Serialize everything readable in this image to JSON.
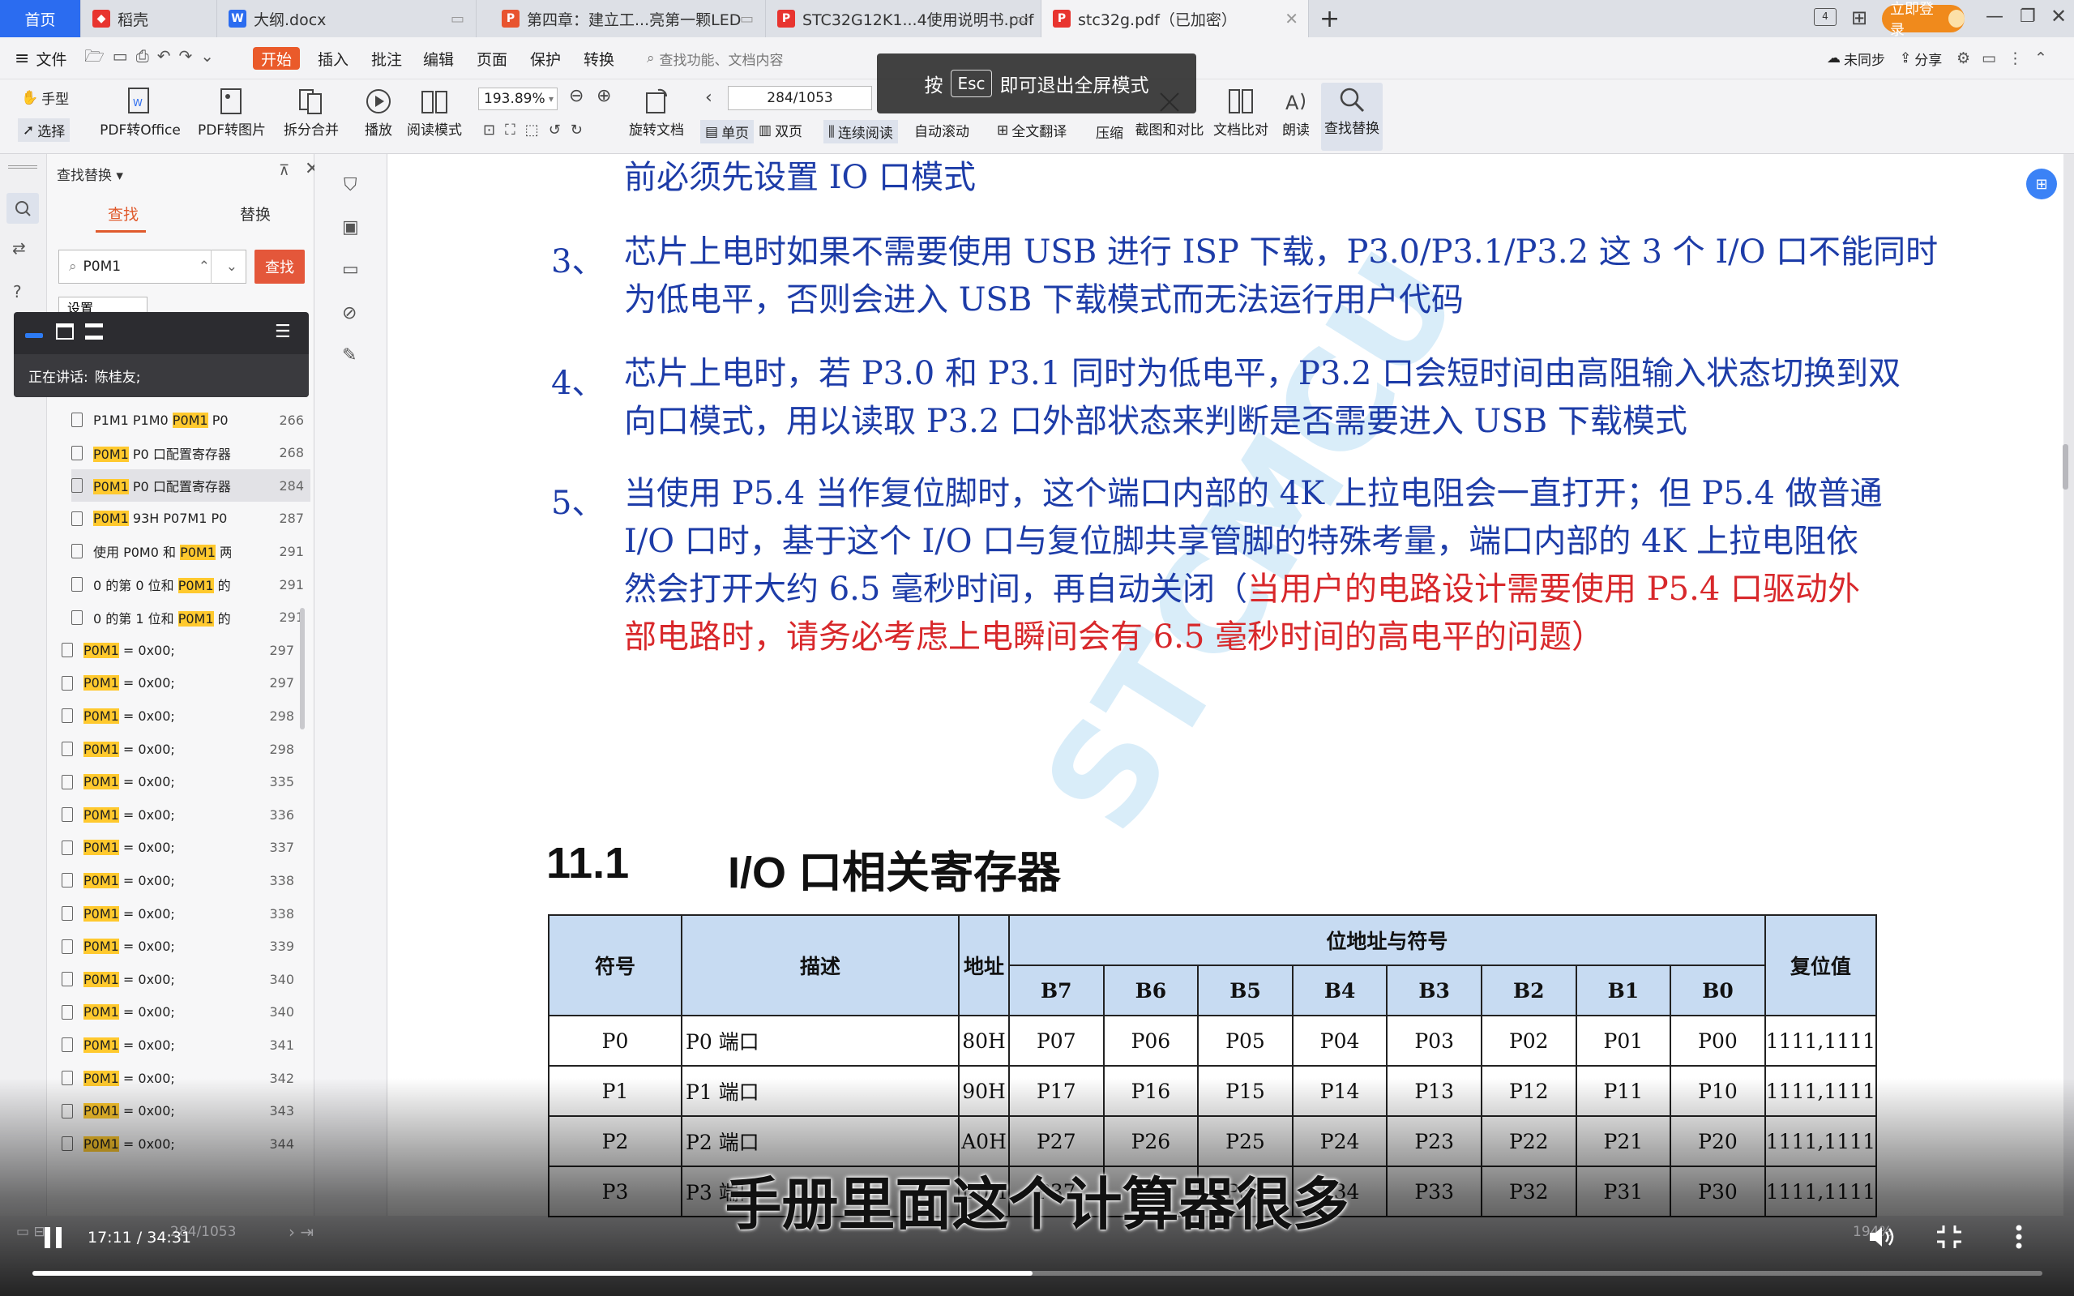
{
  "tabs": [
    {
      "label": "首页",
      "active": true,
      "color": "#2b6cf0"
    },
    {
      "label": "稻壳",
      "icon": "docer-icon",
      "color": "#e8342f"
    },
    {
      "label": "大纲.docx",
      "icon": "word-icon",
      "color": "#2b6cf0"
    },
    {
      "label": "第四章：建立工...亮第一颗LED",
      "icon": "wps-pdf-icon",
      "color": "#e8542f"
    },
    {
      "label": "STC32G12K1...4使用说明书.pdf",
      "icon": "wps-pdf-icon",
      "color": "#e8342f"
    },
    {
      "label": "stc32g.pdf（已加密）",
      "icon": "wps-pdf-icon",
      "color": "#e8342f"
    }
  ],
  "titlebar": {
    "login": "立即登录"
  },
  "menu": {
    "file": "文件",
    "items": [
      "开始",
      "插入",
      "批注",
      "编辑",
      "页面",
      "保护",
      "转换"
    ],
    "search": "查找功能、文档内容",
    "unsync": "未同步",
    "share": "分享"
  },
  "toolbar": {
    "hand": "手型",
    "select": "选择",
    "pdf_office": "PDF转Office",
    "pdf_image": "PDF转图片",
    "split_merge": "拆分合并",
    "play": "播放",
    "read_mode": "阅读模式",
    "zoom": "193.89%",
    "page": "284/1053",
    "rotate": "旋转文档",
    "single": "单页",
    "double": "双页",
    "continuous": "连续阅读",
    "autoscroll": "自动滚动",
    "translate": "全文翻译",
    "compress": "压缩",
    "screenshot": "截图和对比",
    "compare": "文档比对",
    "read_aloud": "朗读",
    "find_replace": "查找替换"
  },
  "toast": {
    "press": "按",
    "key": "Esc",
    "text": "即可退出全屏模式"
  },
  "find_panel": {
    "title": "查找替换",
    "tab_find": "查找",
    "tab_replace": "替换",
    "query": "P0M1",
    "button": "查找",
    "settings": "设置"
  },
  "speaker": {
    "label": "正在讲话:",
    "name": "陈桂友;"
  },
  "results": [
    {
      "pre": "P1M1 P1M0 ",
      "hl": "P0M1",
      "post": " P0",
      "page": "266"
    },
    {
      "pre": "",
      "hl": "P0M1",
      "post": " P0 口配置寄存器",
      "page": "268"
    },
    {
      "pre": "",
      "hl": "P0M1",
      "post": " P0 口配置寄存器",
      "page": "284"
    },
    {
      "pre": "",
      "hl": "P0M1",
      "post": " 93H P07M1 P0",
      "page": "287"
    },
    {
      "pre": "使用 P0M0 和 ",
      "hl": "P0M1",
      "post": " 两",
      "page": "291"
    },
    {
      "pre": "0 的第 0 位和 ",
      "hl": "P0M1",
      "post": " 的",
      "page": "291"
    },
    {
      "pre": "0 的第 1 位和 ",
      "hl": "P0M1",
      "post": " 的",
      "page": "291"
    },
    {
      "pre": "",
      "hl": "P0M1",
      "post": " = 0x00;",
      "page": "297"
    },
    {
      "pre": "",
      "hl": "P0M1",
      "post": " = 0x00;",
      "page": "297"
    },
    {
      "pre": "",
      "hl": "P0M1",
      "post": " = 0x00;",
      "page": "298"
    },
    {
      "pre": "",
      "hl": "P0M1",
      "post": " = 0x00;",
      "page": "298"
    },
    {
      "pre": "",
      "hl": "P0M1",
      "post": " = 0x00;",
      "page": "335"
    },
    {
      "pre": "",
      "hl": "P0M1",
      "post": " = 0x00;",
      "page": "336"
    },
    {
      "pre": "",
      "hl": "P0M1",
      "post": " = 0x00;",
      "page": "337"
    },
    {
      "pre": "",
      "hl": "P0M1",
      "post": " = 0x00;",
      "page": "338"
    },
    {
      "pre": "",
      "hl": "P0M1",
      "post": " = 0x00;",
      "page": "338"
    },
    {
      "pre": "",
      "hl": "P0M1",
      "post": " = 0x00;",
      "page": "339"
    },
    {
      "pre": "",
      "hl": "P0M1",
      "post": " = 0x00;",
      "page": "340"
    },
    {
      "pre": "",
      "hl": "P0M1",
      "post": " = 0x00;",
      "page": "340"
    },
    {
      "pre": "",
      "hl": "P0M1",
      "post": " = 0x00;",
      "page": "341"
    },
    {
      "pre": "",
      "hl": "P0M1",
      "post": " = 0x00;",
      "page": "342"
    },
    {
      "pre": "",
      "hl": "P0M1",
      "post": " = 0x00;",
      "page": "343"
    },
    {
      "pre": "",
      "hl": "P0M1",
      "post": " = 0x00;",
      "page": "344"
    }
  ],
  "doc": {
    "line0": "前必须先设置 IO 口模式",
    "items": [
      {
        "num": "3、",
        "lines": [
          "芯片上电时如果不需要使用 USB 进行 ISP 下载，P3.0/P3.1/P3.2 这 3 个 I/O 口不能同时",
          "为低电平，否则会进入 USB 下载模式而无法运行用户代码"
        ]
      },
      {
        "num": "4、",
        "lines": [
          "芯片上电时，若 P3.0 和 P3.1 同时为低电平，P3.2 口会短时间由高阻输入状态切换到双",
          "向口模式，用以读取 P3.2 口外部状态来判断是否需要进入 USB 下载模式"
        ]
      },
      {
        "num": "5、",
        "lines": [
          "当使用 P5.4 当作复位脚时，这个端口内部的 4K 上拉电阻会一直打开；但 P5.4 做普通",
          "I/O 口时，基于这个 I/O 口与复位脚共享管脚的特殊考量，端口内部的 4K 上拉电阻依"
        ]
      }
    ],
    "item5_line3_blue": "然会打开大约 6.5 毫秒时间，再自动关闭（",
    "item5_line3_red": "当用户的电路设计需要使用 P5.4 口驱动外",
    "item5_line4_red": "部电路时，请务必考虑上电瞬间会有 6.5 毫秒时间的高电平的问题）",
    "watermark": "STCMCU",
    "section_num": "11.1",
    "section_title": "I/O 口相关寄存器"
  },
  "table": {
    "headers": {
      "symbol": "符号",
      "desc": "描述",
      "addr": "地址",
      "bits_group": "位地址与符号",
      "reset": "复位值"
    },
    "bits": [
      "B7",
      "B6",
      "B5",
      "B4",
      "B3",
      "B2",
      "B1",
      "B0"
    ],
    "rows": [
      {
        "sym": "P0",
        "desc": "P0 端口",
        "addr": "80H",
        "bits": [
          "P07",
          "P06",
          "P05",
          "P04",
          "P03",
          "P02",
          "P01",
          "P00"
        ],
        "reset": "1111,1111"
      },
      {
        "sym": "P1",
        "desc": "P1 端口",
        "addr": "90H",
        "bits": [
          "P17",
          "P16",
          "P15",
          "P14",
          "P13",
          "P12",
          "P11",
          "P10"
        ],
        "reset": "1111,1111"
      },
      {
        "sym": "P2",
        "desc": "P2 端口",
        "addr": "A0H",
        "bits": [
          "P27",
          "P26",
          "P25",
          "P24",
          "P23",
          "P22",
          "P21",
          "P20"
        ],
        "reset": "1111,1111"
      },
      {
        "sym": "P3",
        "desc": "P3 端口",
        "addr": "B0H",
        "bits": [
          "P37",
          "P36",
          "P35",
          "P34",
          "P33",
          "P32",
          "P31",
          "P30"
        ],
        "reset": "1111,1111"
      }
    ]
  },
  "statusbar": {
    "page": "284/1053",
    "zoom": "194%"
  },
  "video": {
    "time": "17:11 / 34:31",
    "progress": 0.4976,
    "subtitle": "手册里面这个计算器很多"
  }
}
